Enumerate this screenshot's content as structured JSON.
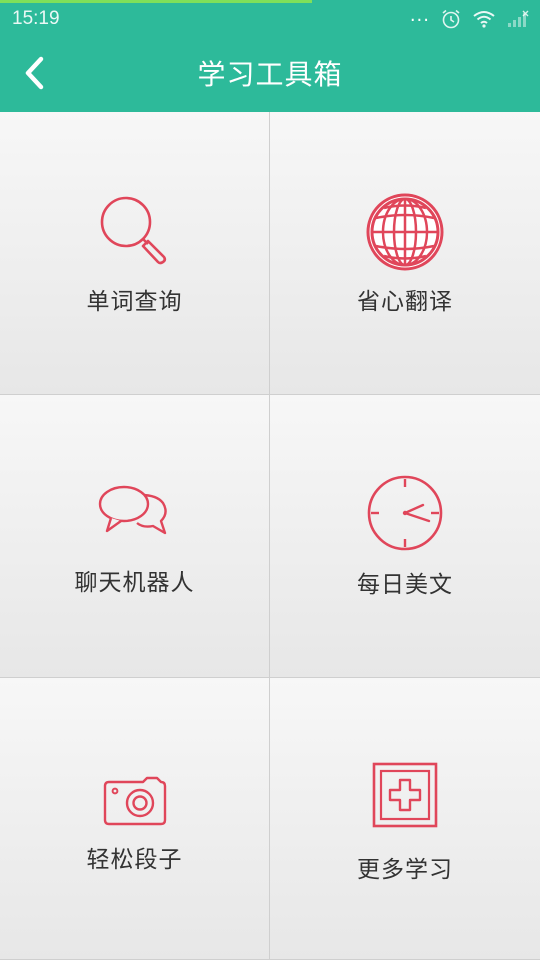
{
  "status_bar": {
    "time": "15:19",
    "overflow": "...",
    "icons": [
      "alarm-icon",
      "wifi-icon",
      "signal-icon"
    ]
  },
  "header": {
    "title": "学习工具箱",
    "back_icon": "chevron-left-icon",
    "background": "#2dba9a"
  },
  "tools": [
    {
      "label": "单词查询",
      "icon": "magnifier-icon"
    },
    {
      "label": "省心翻译",
      "icon": "globe-icon"
    },
    {
      "label": "聊天机器人",
      "icon": "chat-bubbles-icon"
    },
    {
      "label": "每日美文",
      "icon": "clock-icon"
    },
    {
      "label": "轻松段子",
      "icon": "camera-icon"
    },
    {
      "label": "更多学习",
      "icon": "add-box-icon"
    }
  ],
  "colors": {
    "accent": "#2dba9a",
    "icon_stroke": "#e0465a",
    "label_text": "#333333"
  }
}
